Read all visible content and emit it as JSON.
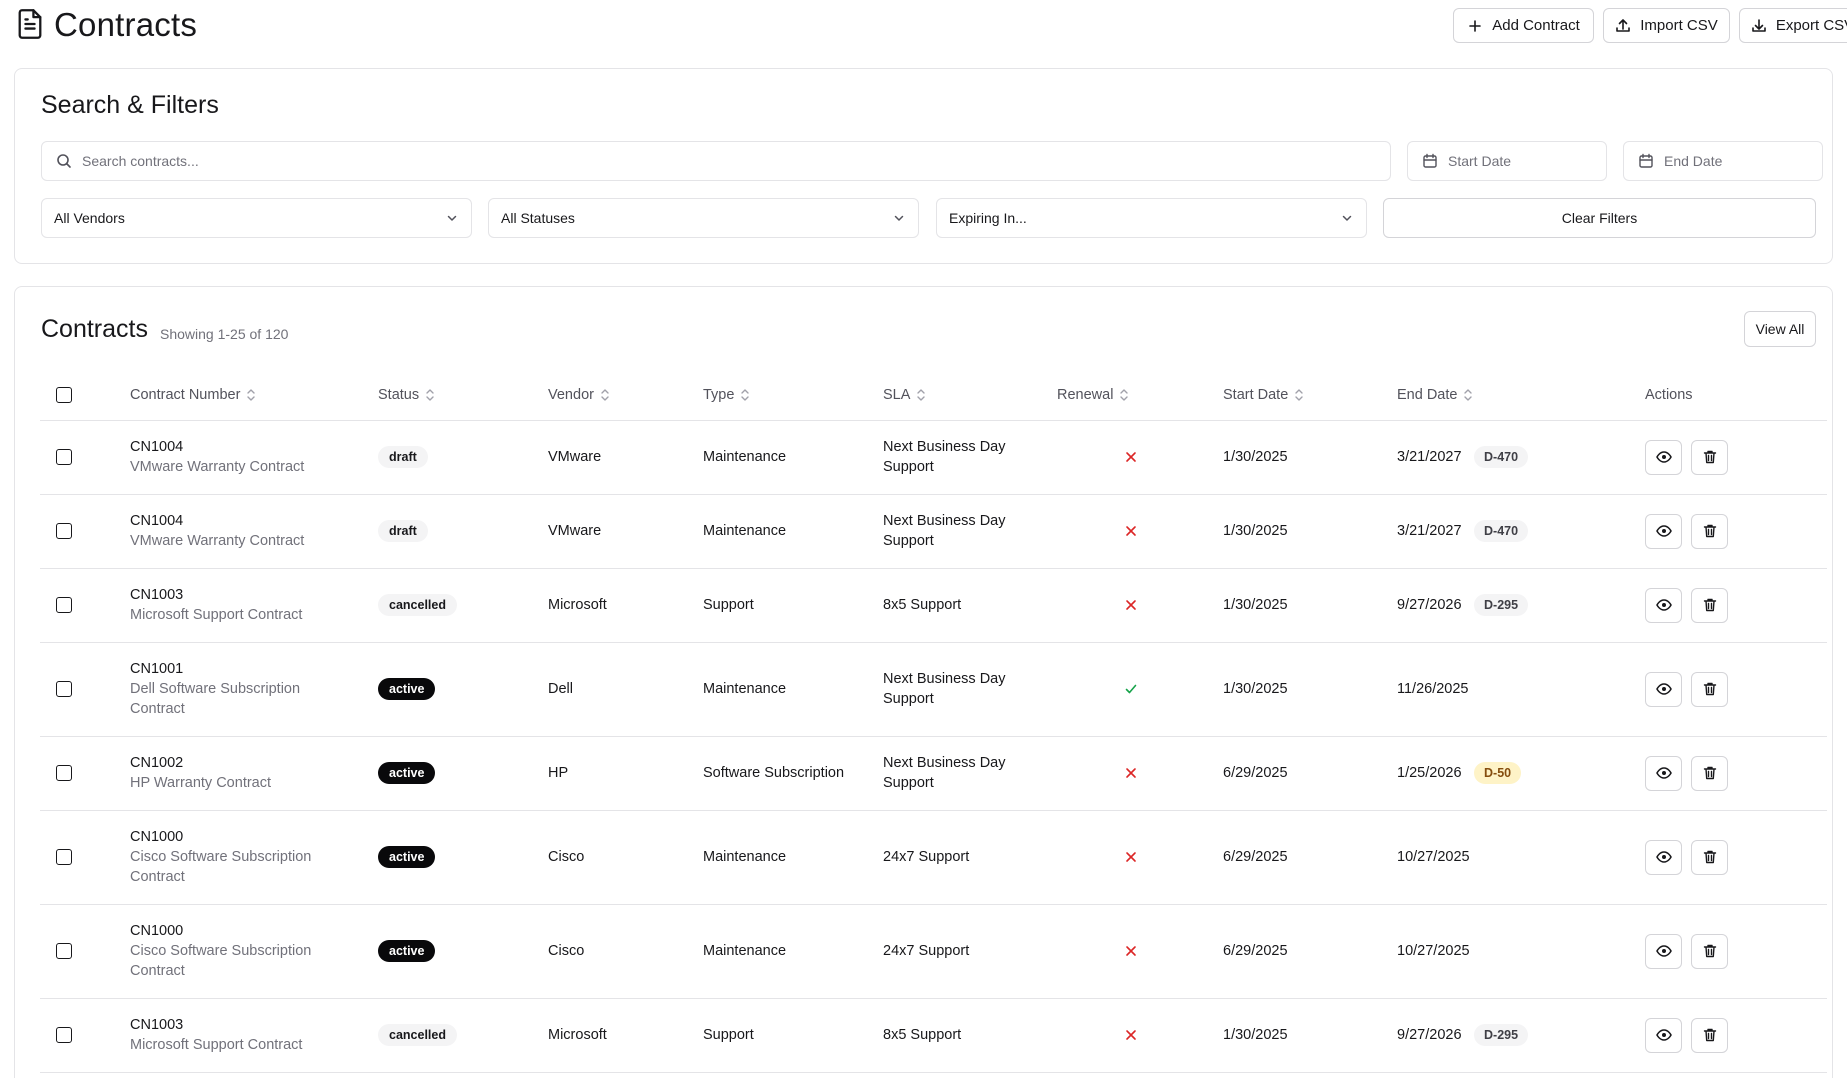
{
  "header": {
    "title": "Contracts",
    "add_label": "Add Contract",
    "import_label": "Import CSV",
    "export_label": "Export CSV"
  },
  "filters": {
    "title": "Search & Filters",
    "search_placeholder": "Search contracts...",
    "start_date_placeholder": "Start Date",
    "end_date_placeholder": "End Date",
    "vendor_value": "All Vendors",
    "status_value": "All Statuses",
    "expiring_value": "Expiring In...",
    "clear_label": "Clear Filters"
  },
  "table": {
    "title": "Contracts",
    "subtitle": "Showing 1-25 of 120",
    "view_all_label": "View All",
    "columns": [
      "Contract Number",
      "Status",
      "Vendor",
      "Type",
      "SLA",
      "Renewal",
      "Start Date",
      "End Date",
      "Actions"
    ],
    "rows": [
      {
        "number": "CN1004",
        "name": [
          "VMware Warranty Contract"
        ],
        "status": "draft",
        "vendor": "VMware",
        "type": "Maintenance",
        "sla": [
          "Next Business Day",
          "Support"
        ],
        "renewal": false,
        "start": "1/30/2025",
        "end": "3/21/2027",
        "days": "D-470",
        "days_warn": false
      },
      {
        "number": "CN1004",
        "name": [
          "VMware Warranty Contract"
        ],
        "status": "draft",
        "vendor": "VMware",
        "type": "Maintenance",
        "sla": [
          "Next Business Day",
          "Support"
        ],
        "renewal": false,
        "start": "1/30/2025",
        "end": "3/21/2027",
        "days": "D-470",
        "days_warn": false
      },
      {
        "number": "CN1003",
        "name": [
          "Microsoft Support Contract"
        ],
        "status": "cancelled",
        "vendor": "Microsoft",
        "type": "Support",
        "sla": [
          "8x5 Support"
        ],
        "renewal": false,
        "start": "1/30/2025",
        "end": "9/27/2026",
        "days": "D-295",
        "days_warn": false
      },
      {
        "number": "CN1001",
        "name": [
          "Dell Software Subscription",
          "Contract"
        ],
        "status": "active",
        "vendor": "Dell",
        "type": "Maintenance",
        "sla": [
          "Next Business Day",
          "Support"
        ],
        "renewal": true,
        "start": "1/30/2025",
        "end": "11/26/2025",
        "days": "",
        "days_warn": false
      },
      {
        "number": "CN1002",
        "name": [
          "HP Warranty Contract"
        ],
        "status": "active",
        "vendor": "HP",
        "type": "Software Subscription",
        "sla": [
          "Next Business Day",
          "Support"
        ],
        "renewal": false,
        "start": "6/29/2025",
        "end": "1/25/2026",
        "days": "D-50",
        "days_warn": true
      },
      {
        "number": "CN1000",
        "name": [
          "Cisco Software Subscription",
          "Contract"
        ],
        "status": "active",
        "vendor": "Cisco",
        "type": "Maintenance",
        "sla": [
          "24x7 Support"
        ],
        "renewal": false,
        "start": "6/29/2025",
        "end": "10/27/2025",
        "days": "",
        "days_warn": false
      },
      {
        "number": "CN1000",
        "name": [
          "Cisco Software Subscription",
          "Contract"
        ],
        "status": "active",
        "vendor": "Cisco",
        "type": "Maintenance",
        "sla": [
          "24x7 Support"
        ],
        "renewal": false,
        "start": "6/29/2025",
        "end": "10/27/2025",
        "days": "",
        "days_warn": false
      },
      {
        "number": "CN1003",
        "name": [
          "Microsoft Support Contract"
        ],
        "status": "cancelled",
        "vendor": "Microsoft",
        "type": "Support",
        "sla": [
          "8x5 Support"
        ],
        "renewal": false,
        "start": "1/30/2025",
        "end": "9/27/2026",
        "days": "D-295",
        "days_warn": false
      }
    ]
  },
  "icons": {
    "page": "document-icon",
    "add": "plus-icon",
    "import": "upload-icon",
    "export": "download-icon",
    "search": "search-icon",
    "calendar": "calendar-icon",
    "chevron": "chevron-down-icon",
    "sort": "sort-icon",
    "view": "eye-icon",
    "delete": "trash-icon",
    "renewal_yes": "check-icon",
    "renewal_no": "x-icon"
  },
  "colors": {
    "renewal_no": "#dc2626",
    "renewal_yes": "#16a34a",
    "active_badge": "#09090b",
    "warn_badge": "#fef3c7"
  }
}
